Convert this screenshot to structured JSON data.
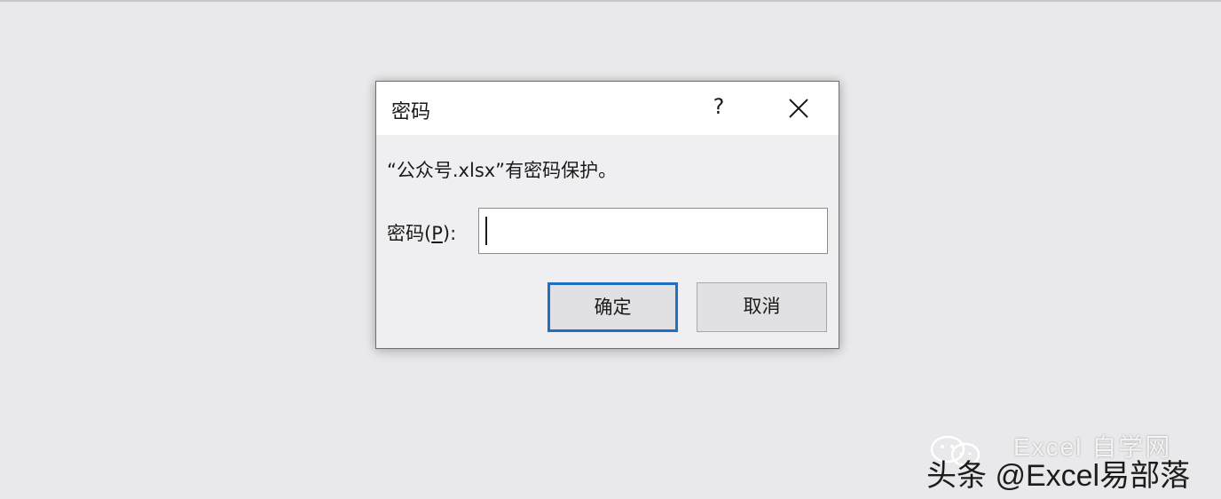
{
  "dialog": {
    "title": "密码",
    "help_label": "?",
    "message": "“公众号.xlsx”有密码保护。",
    "password_label_prefix": "密码(",
    "password_label_accel": "P",
    "password_label_suffix": "):",
    "password_value": "",
    "ok_label": "确定",
    "cancel_label": "取消"
  },
  "watermark": {
    "line1": "Excel 自学网",
    "line2": "头条 @Excel易部落"
  },
  "colors": {
    "background": "#e9e8ea",
    "dialog_body": "#efeef0",
    "titlebar": "#ffffff",
    "focus_border": "#1f6fc4"
  }
}
